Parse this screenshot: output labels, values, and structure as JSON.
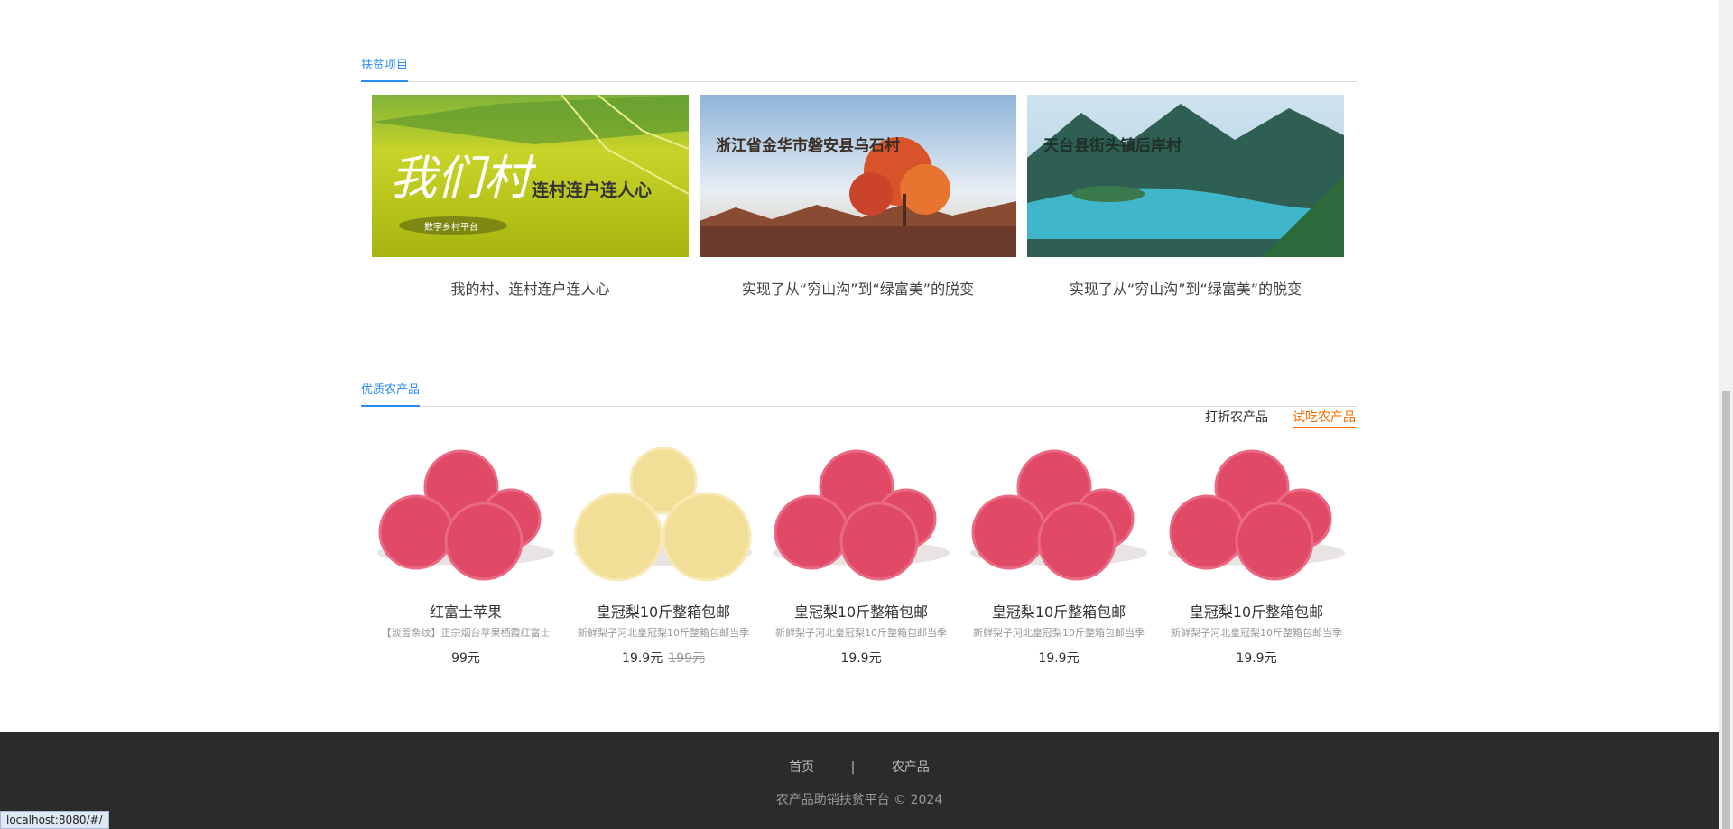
{
  "sections": {
    "projects_tab": "扶贫项目",
    "products_tab": "优质农产品"
  },
  "projects": [
    {
      "caption": "我的村、连村连户连人心",
      "overlay_title": "我们村",
      "overlay_sub": "连村连户连人心",
      "overlay_badge": "数字乡村平台"
    },
    {
      "caption": "实现了从“穷山沟”到“绿富美”的脱变",
      "overlay_title": "浙江省金华市磐安县乌石村"
    },
    {
      "caption": "实现了从“穷山沟”到“绿富美”的脱变",
      "overlay_title": "天台县街头镇后岸村"
    }
  ],
  "filters": [
    "打折农产品",
    "试吃农产品"
  ],
  "products": [
    {
      "name": "红富士苹果",
      "desc": "【淡雪条纹】正宗烟台苹果栖霞红富士",
      "price": "99元",
      "old_price": "",
      "fruit": "apple"
    },
    {
      "name": "皇冠梨10斤整箱包邮",
      "desc": "新鲜梨子河北皇冠梨10斤整箱包邮当季",
      "price": "19.9元",
      "old_price": "199元",
      "fruit": "pear"
    },
    {
      "name": "皇冠梨10斤整箱包邮",
      "desc": "新鲜梨子河北皇冠梨10斤整箱包邮当季",
      "price": "19.9元",
      "old_price": "",
      "fruit": "apple"
    },
    {
      "name": "皇冠梨10斤整箱包邮",
      "desc": "新鲜梨子河北皇冠梨10斤整箱包邮当季",
      "price": "19.9元",
      "old_price": "",
      "fruit": "apple"
    },
    {
      "name": "皇冠梨10斤整箱包邮",
      "desc": "新鲜梨子河北皇冠梨10斤整箱包邮当季",
      "price": "19.9元",
      "old_price": "",
      "fruit": "apple"
    }
  ],
  "footer": {
    "links": [
      "首页",
      "|",
      "农产品"
    ],
    "copyright": "农产品助销扶贫平台 © 2024"
  },
  "status_url": "localhost:8080/#/",
  "colors": {
    "accent": "#2d8cf0",
    "active_filter": "#f56c00",
    "footer_bg": "#2b2b2b"
  }
}
